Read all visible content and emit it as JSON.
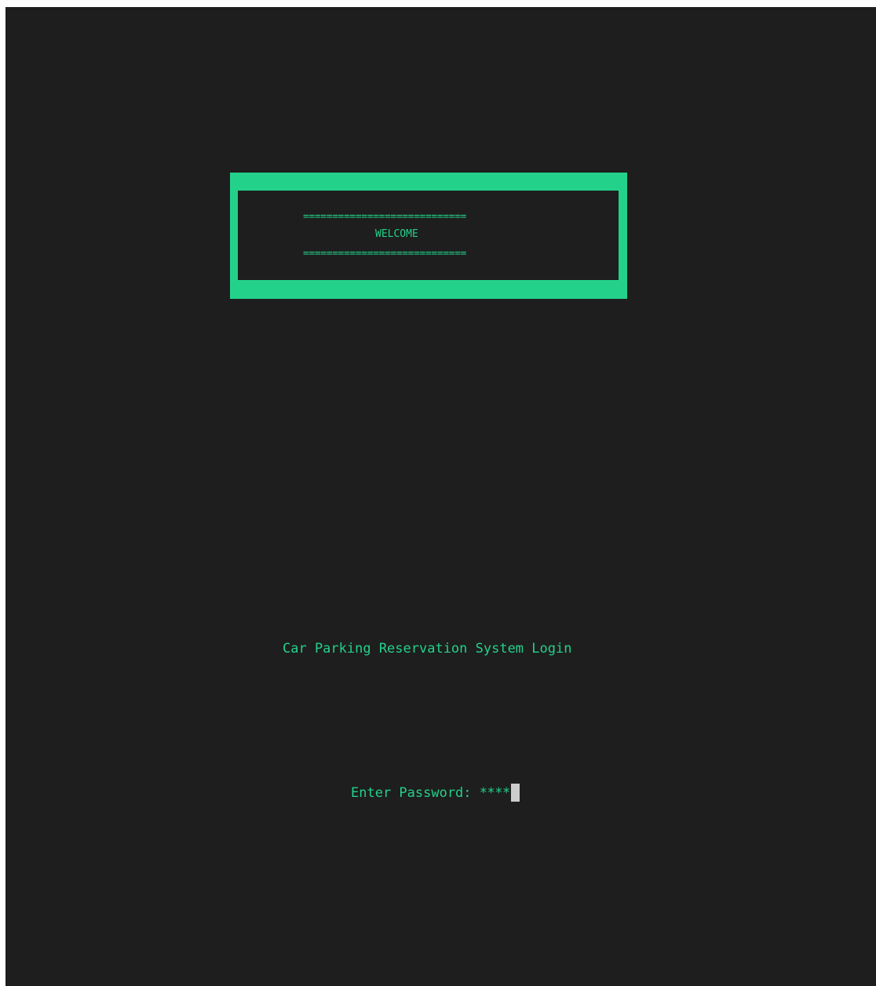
{
  "colors": {
    "background": "#1e1e1e",
    "accent": "#23d18b",
    "cursor": "#cccccc"
  },
  "banner": {
    "rule_top": "============================",
    "welcome": "WELCOME",
    "rule_bottom": "============================"
  },
  "login": {
    "title": "Car Parking Reservation System Login",
    "password_label": "Enter Password: ",
    "password_value": "****"
  }
}
